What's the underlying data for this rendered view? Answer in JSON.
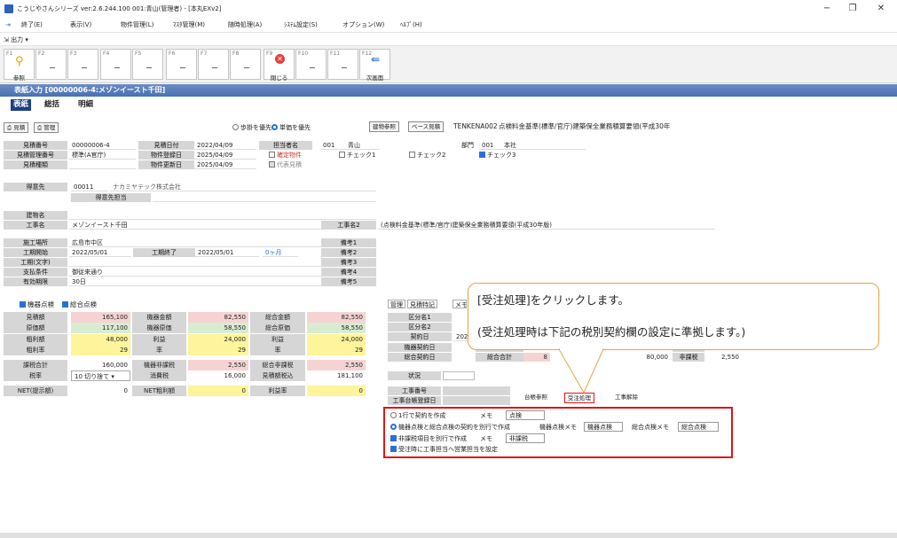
{
  "window": {
    "title": "こうじやさんシリーズ  ver:2.6.244.100  001:青山(管理者) - [本丸EXv2]",
    "minimize": "−",
    "maximize": "❐",
    "close": "✕"
  },
  "menu": [
    "終了(E)",
    "表示(V)",
    "物件管理(L)",
    "ﾏｽﾀ管理(M)",
    "随時処理(A)",
    "ｼｽﾃﾑ設定(S)",
    "オプション(W)",
    "ﾍﾙﾌﾟ(H)"
  ],
  "output_menu": "出力 ▾",
  "fkeys": [
    {
      "key": "F1",
      "label": "参照"
    },
    {
      "key": "F2",
      "label": ""
    },
    {
      "key": "F3",
      "label": ""
    },
    {
      "key": "F4",
      "label": ""
    },
    {
      "key": "F5",
      "label": ""
    },
    {
      "key": "F6",
      "label": ""
    },
    {
      "key": "F7",
      "label": ""
    },
    {
      "key": "F8",
      "label": ""
    },
    {
      "key": "F9",
      "label": "閉じる"
    },
    {
      "key": "F10",
      "label": ""
    },
    {
      "key": "F11",
      "label": ""
    },
    {
      "key": "F12",
      "label": "次画面"
    }
  ],
  "section_title": "表紙入力 [00000006-4:メゾンイースト千田]",
  "tabs": [
    "表紙",
    "総括",
    "明細"
  ],
  "toolbar": {
    "estimate_btn": "見積",
    "manage_btn": "管理",
    "radio_ratio": "歩掛を優先",
    "radio_unit": "単価を優先",
    "building_ref": "建物参照",
    "base_estimate": "ベース見積",
    "base_code": "TENKENA002",
    "base_title": "点検料金基準(標準/官庁)建築保全業務積算要領(平成30年"
  },
  "header": {
    "est_no_label": "見積番号",
    "est_no": "00000006-4",
    "est_date_label": "見積日付",
    "est_date": "2022/04/09",
    "staff_label": "担当者名",
    "staff_code": "001",
    "staff_name": "青山",
    "dept_label": "部門",
    "dept_code": "001",
    "dept_name": "本社",
    "mgmt_no_label": "見積管理番号",
    "mgmt_no": "標準(A官庁)",
    "reg_date_label": "物件登録日",
    "reg_date": "2025/04/09",
    "confirmed": "確定物件",
    "check1": "チェック1",
    "check2": "チェック2",
    "check3": "チェック3",
    "kind_label": "見積種類",
    "upd_date_label": "物件更新日",
    "upd_date": "2025/04/09",
    "rep_est": "代表見積"
  },
  "customer": {
    "label": "得意先",
    "code": "00011",
    "name": "ナカミヤテック株式会社",
    "person_label": "得意先担当"
  },
  "building": {
    "label": "建物名",
    "value": ""
  },
  "work": {
    "label": "工事名",
    "value": "メゾンイースト千田",
    "label2": "工事名2",
    "value2": "(点検料金基準(標準/官庁)建築保全業務積算要領(平成30年版)"
  },
  "details": {
    "site_label": "施工場所",
    "site": "広島市中区",
    "start_label": "工期開始",
    "start": "2022/05/01",
    "end_label": "工期終了",
    "end": "2022/05/01",
    "months": "0ヶ月",
    "period_text_label": "工期(文字)",
    "pay_label": "支払条件",
    "pay": "御従来通り",
    "valid_label": "有効期限",
    "valid": "30日",
    "remarks": [
      "備考1",
      "備考2",
      "備考3",
      "備考4",
      "備考5"
    ]
  },
  "totals": {
    "chk_equipment": "機器点検",
    "chk_total": "総合点検",
    "rows": [
      [
        "見積額",
        "165,100",
        "機器金額",
        "82,550",
        "総合金額",
        "82,550"
      ],
      [
        "原価額",
        "117,100",
        "機器原価",
        "58,550",
        "総合原価",
        "58,550"
      ],
      [
        "粗利額",
        "48,000",
        "利益",
        "24,000",
        "利益",
        "24,000"
      ],
      [
        "粗利率",
        "29",
        "率",
        "29",
        "率",
        "29"
      ],
      [
        "課税合計",
        "160,000",
        "機器非課税",
        "2,550",
        "総合非課税",
        "2,550"
      ],
      [
        "税率",
        "10 切り捨て ▾",
        "消費税",
        "16,000",
        "見積額税込",
        "181,100"
      ],
      [
        "NET(提示額)",
        "0",
        "NET粗利額",
        "0",
        "利益率",
        "0"
      ]
    ]
  },
  "right_panel": {
    "tabs": [
      "管理",
      "見積特記",
      "メモ"
    ],
    "class1": "区分名1",
    "class2": "区分名2",
    "contract_date_label": "契約日",
    "contract_date": "2022/04/",
    "equip_contract_label": "機器契約日",
    "total_contract_label": "総合契約日",
    "equip_total_label": "機器合計",
    "total_total_label": "総合合計",
    "status_label": "状況",
    "work_no_label": "工事番号",
    "work_reg_label": "工事台帳登録日",
    "amount1": "80,000",
    "nontax1_label": "非課税",
    "nontax1": "2,550",
    "amount2": "80,000",
    "nontax2_label": "非課税",
    "nontax2": "2,550",
    "partial_amount": "8",
    "ledger_btn": "台帳参照",
    "order_btn": "受注処理",
    "work_release_btn": "工事解除"
  },
  "order_options": {
    "opt1": "1行で契約を作成",
    "memo_label1": "メモ",
    "memo1": "点検",
    "opt2": "機器点検と総合点検の契約を別行で作成",
    "equip_memo_label": "機器点検メモ",
    "equip_memo": "機器点検",
    "total_memo_label": "総合点検メモ",
    "total_memo": "総合点検",
    "opt3": "非課税項目を別行で作成",
    "memo_label3": "メモ",
    "memo3": "非課税",
    "opt4": "受注時に工事担当へ営業担当を設定"
  },
  "callout": {
    "line1": "[受注処理]をクリックします。",
    "line2": "(受注処理時は下記の税別契約欄の設定に準拠します。)"
  },
  "colors": {
    "accent": "#1f3f87",
    "highlight": "#e01414",
    "callout_border": "#e8a33d"
  }
}
